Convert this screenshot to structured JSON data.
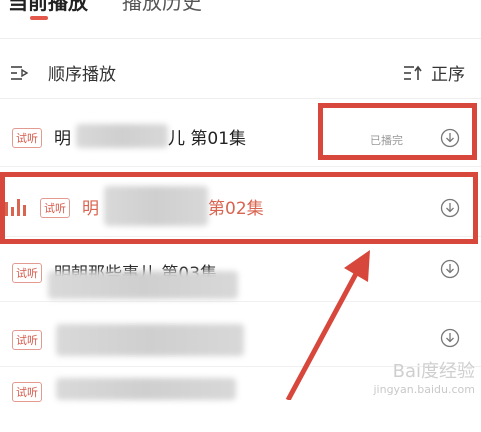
{
  "tabs": {
    "current": "当前播放",
    "history": "播放历史"
  },
  "toolbar": {
    "sequential_label": "顺序播放",
    "order_label": "正序"
  },
  "episodes": [
    {
      "tag": "试听",
      "title_prefix": "明",
      "title_suffix": "儿 第01集",
      "status": "已播完"
    },
    {
      "tag": "试听",
      "title_prefix": "明",
      "title_suffix": "第02集",
      "status": ""
    },
    {
      "tag": "试听",
      "title_prefix": "明朝那些事儿 第03集",
      "title_suffix": "",
      "status": ""
    },
    {
      "tag": "试听",
      "title_prefix": "",
      "title_suffix": "",
      "status": ""
    },
    {
      "tag": "试听",
      "title_prefix": "",
      "title_suffix": "",
      "status": ""
    }
  ],
  "watermark": {
    "line1": "Bai度经验",
    "line2": "jingyan.baidu.com"
  },
  "colors": {
    "accent": "#d9644f",
    "highlight_box": "#d8473b"
  }
}
